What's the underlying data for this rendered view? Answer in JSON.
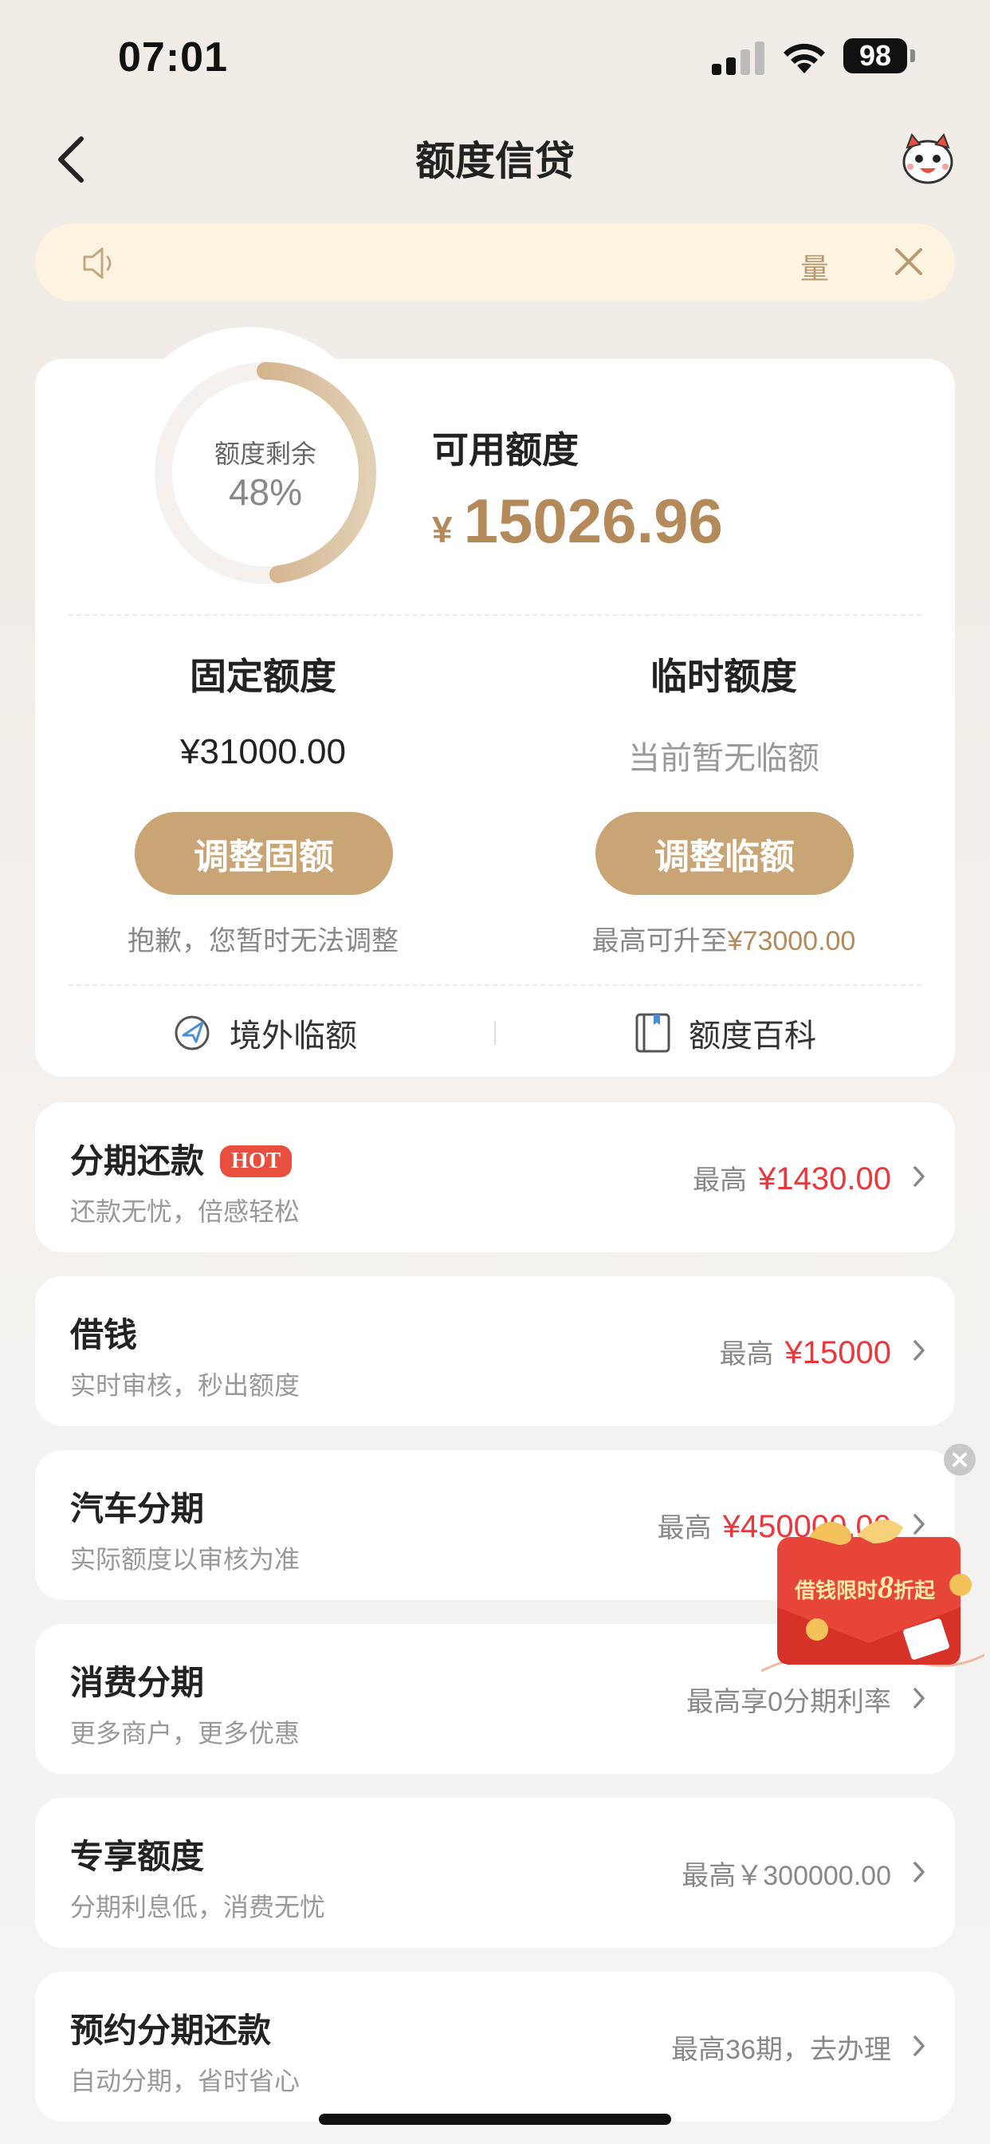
{
  "status_bar": {
    "time": "07:01",
    "battery": "98"
  },
  "header": {
    "title": "额度信贷"
  },
  "notice": {
    "text": "量"
  },
  "summary": {
    "ring_label": "额度剩余",
    "ring_percent": "48%",
    "ring_fraction": 0.48,
    "available_label": "可用额度",
    "currency": "¥",
    "available_amount": "15026.96",
    "fixed": {
      "title": "固定额度",
      "value": "¥31000.00",
      "button": "调整固额",
      "note": "抱歉，您暂时无法调整"
    },
    "temporary": {
      "title": "临时额度",
      "value": "当前暂无临额",
      "button": "调整临额",
      "note_prefix": "最高可升至",
      "note_amount": "¥73000.00"
    },
    "links": {
      "overseas": "境外临额",
      "encyclopedia": "额度百科"
    }
  },
  "items": [
    {
      "title": "分期还款",
      "badge": "HOT",
      "subtitle": "还款无忧，倍感轻松",
      "right_label": "最高",
      "right_value": "¥1430.00"
    },
    {
      "title": "借钱",
      "subtitle": "实时审核，秒出额度",
      "right_label": "最高",
      "right_value": "¥15000"
    },
    {
      "title": "汽车分期",
      "subtitle": "实际额度以审核为准",
      "right_label": "最高",
      "right_value": "¥450000.00"
    },
    {
      "title": "消费分期",
      "subtitle": "更多商户，更多优惠",
      "right_label": "最高享0分期利率"
    },
    {
      "title": "专享额度",
      "subtitle": "分期利息低，消费无忧",
      "right_label": "最高￥300000.00"
    },
    {
      "title": "预约分期还款",
      "subtitle": "自动分期，省时省心",
      "right_label": "最高36期，去办理"
    }
  ],
  "promo": {
    "text_prefix": "借钱限时",
    "text_number": "8",
    "text_suffix": "折起"
  },
  "colors": {
    "gold": "#c9a474",
    "gold_text": "#b48a5a",
    "red": "#e8383d",
    "notice_bg": "#fcf3e1"
  }
}
